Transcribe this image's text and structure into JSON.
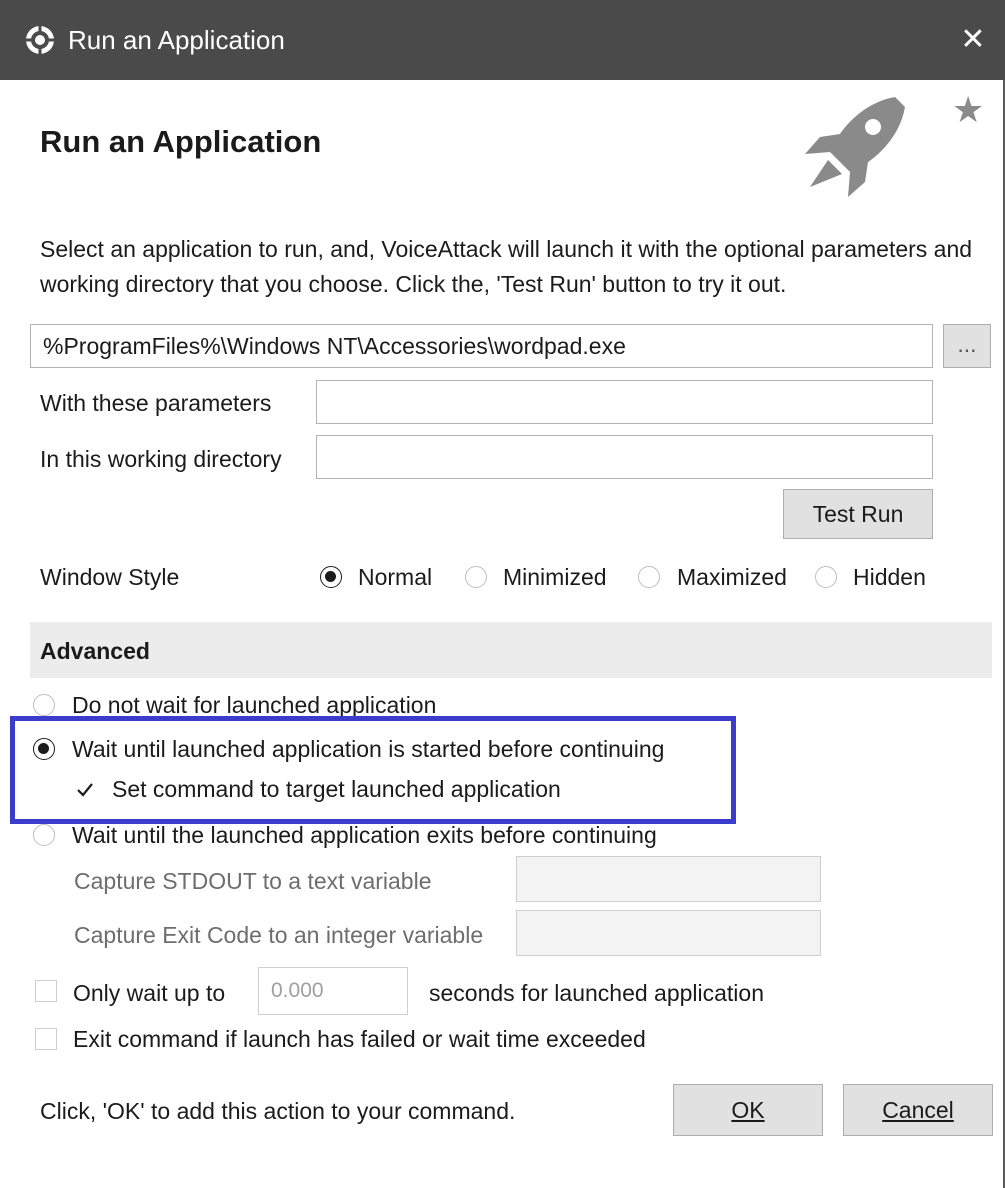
{
  "window": {
    "title": "Run an Application",
    "close_glyph": "✕",
    "icon": "voiceattack-gear-icon",
    "star_glyph": "★"
  },
  "header": {
    "heading": "Run an Application",
    "icon": "rocket-icon",
    "star_icon": "star-icon"
  },
  "description": "Select an application to run, and, VoiceAttack will launch it with the optional parameters and working directory that you choose.  Click the, 'Test Run' button to try it out.",
  "app_path": {
    "value": "%ProgramFiles%\\Windows NT\\Accessories\\wordpad.exe",
    "browse_label": "..."
  },
  "parameters": {
    "label": "With these parameters",
    "value": ""
  },
  "working_dir": {
    "label": "In this working directory",
    "value": ""
  },
  "test_run_label": "Test Run",
  "window_style": {
    "label": "Window Style",
    "options": [
      "Normal",
      "Minimized",
      "Maximized",
      "Hidden"
    ],
    "selected": "Normal"
  },
  "advanced": {
    "heading": "Advanced",
    "options": [
      "Do not wait for launched application",
      "Wait until launched application is started before continuing",
      "Wait until the launched application exits before continuing"
    ],
    "selected": "Wait until launched application is started before continuing",
    "set_target_label": "Set command to target launched application",
    "set_target_checked": true,
    "capture_stdout_label": "Capture STDOUT to a text variable",
    "capture_exit_label": "Capture Exit Code to an integer variable",
    "only_wait_label": "Only wait up to",
    "only_wait_value": "0.000",
    "only_wait_suffix": "seconds for launched application",
    "exit_command_label": "Exit command if launch has failed or wait time exceeded"
  },
  "footer": {
    "hint": "Click, 'OK' to add this action to your command.",
    "ok_label": "OK",
    "cancel_label": "Cancel"
  },
  "colors": {
    "titlebar": "#4a4a4a",
    "highlight": "#3b3bcc",
    "advanced_bar": "#ececec"
  }
}
